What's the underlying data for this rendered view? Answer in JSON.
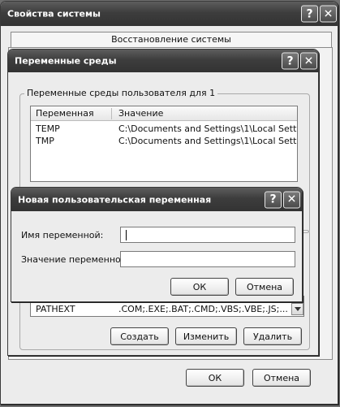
{
  "system_properties": {
    "title": "Свойства системы",
    "tab_label": "Восстановление системы",
    "ok_label": "ОК",
    "cancel_label": "Отмена"
  },
  "env_vars": {
    "title": "Переменные среды",
    "user_group_label": "Переменные среды пользователя для 1",
    "columns": [
      "Переменная",
      "Значение"
    ],
    "user_rows": [
      {
        "name": "TEMP",
        "value": "C:\\Documents and Settings\\1\\Local Sett..."
      },
      {
        "name": "TMP",
        "value": "C:\\Documents and Settings\\1\\Local Sett..."
      }
    ],
    "system_row_partial": {
      "name": "PATHEXT",
      "value": ".COM;.EXE;.BAT;.CMD;.VBS;.VBE;.JS;...."
    },
    "create_label": "Создать",
    "edit_label": "Изменить",
    "delete_label": "Удалить"
  },
  "new_var": {
    "title": "Новая пользовательская переменная",
    "name_label": "Имя переменной:",
    "value_label": "Значение переменной:",
    "name_value": "",
    "value_value": "",
    "ok_label": "ОК",
    "cancel_label": "Отмена"
  },
  "titlebar_buttons": {
    "help": "?",
    "close": "✕"
  }
}
